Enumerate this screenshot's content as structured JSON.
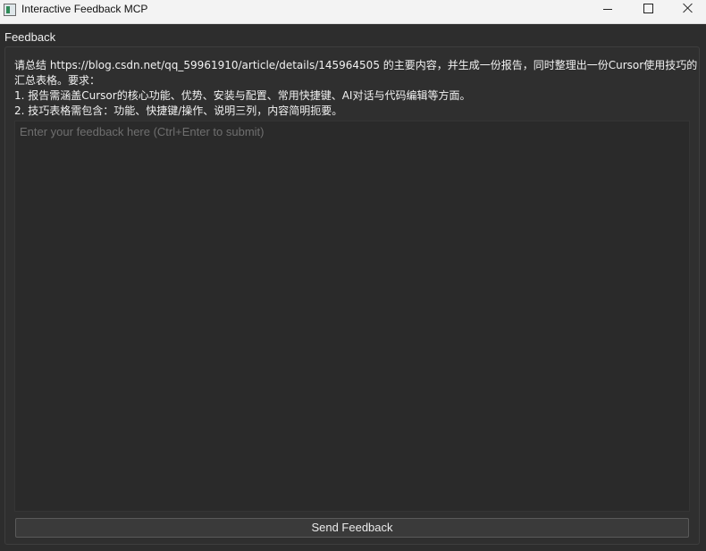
{
  "window": {
    "title": "Interactive Feedback MCP"
  },
  "title_bar_buttons": {
    "minimize_icon": "minimize-icon",
    "maximize_icon": "maximize-icon",
    "close_icon": "close-icon"
  },
  "feedback_group": {
    "title": "Feedback",
    "prompt_lines": [
      "请总结 https://blog.csdn.net/qq_59961910/article/details/145964505 的主要内容，并生成一份报告，同时整理出一份Cursor使用技巧的",
      "汇总表格。要求：",
      "1. 报告需涵盖Cursor的核心功能、优势、安装与配置、常用快捷键、AI对话与代码编辑等方面。",
      "2. 技巧表格需包含：功能、快捷键/操作、说明三列，内容简明扼要。"
    ],
    "input": {
      "value": "",
      "placeholder": "Enter your feedback here (Ctrl+Enter to submit)"
    },
    "send_button_label": "Send Feedback"
  },
  "colors": {
    "background": "#2d2d2d",
    "titlebar": "#f3f3f3",
    "text": "#f2f2f2",
    "placeholder": "#6f6f6f"
  }
}
